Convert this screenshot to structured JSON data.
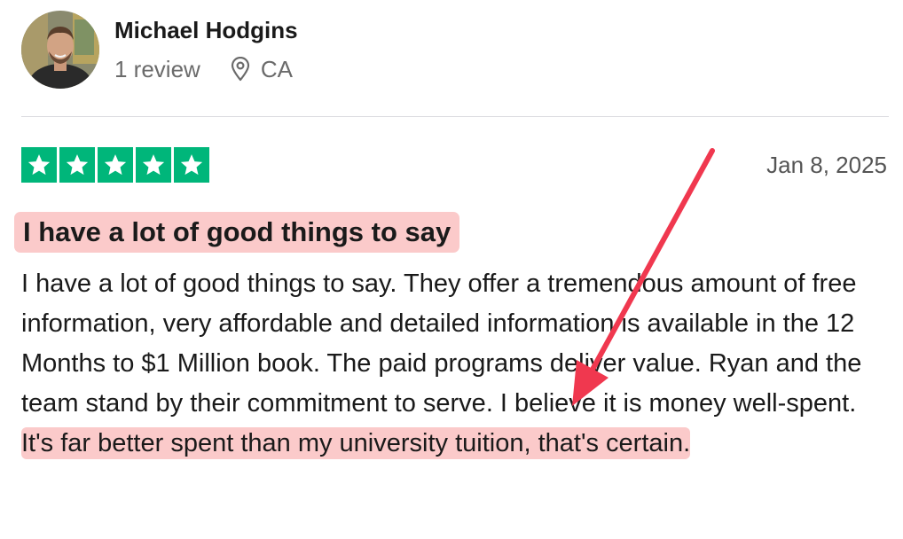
{
  "reviewer": {
    "name": "Michael Hodgins",
    "review_count": "1 review",
    "location": "CA"
  },
  "review": {
    "rating": 5,
    "date": "Jan 8, 2025",
    "title": "I have a lot of good things to say",
    "body_plain": "I have a lot of good things to say. They offer a tremendous amount of free information, very affordable and detailed information is available in the 12 Months to $1 Million book. The paid programs deliver value. Ryan and the team stand by their commitment to serve. I believe it is money well-spent.",
    "body_highlight": " It's far better spent than my university tuition, that's certain."
  },
  "colors": {
    "star_green": "#00b67a",
    "highlight": "#fbcaca",
    "arrow": "#f0384f"
  },
  "icons": {
    "avatar": "reviewer-avatar-photo",
    "location": "map-pin-icon",
    "star": "star-icon",
    "annotation": "red-arrow"
  }
}
